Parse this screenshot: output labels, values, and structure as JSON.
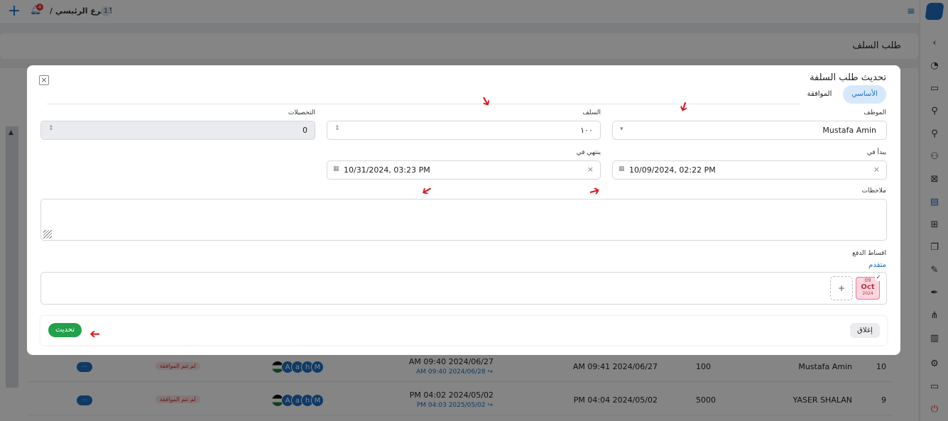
{
  "topbar": {
    "breadcrumb": "الفرع الرئيسي /",
    "branch_number": "1",
    "notifications_count": "4"
  },
  "page": {
    "title": "طلب السلف"
  },
  "table": {
    "rows": [
      {
        "index": "10",
        "employee": "Mustafa Amin",
        "amount": "100",
        "created": "AM 09:41 2024/06/27",
        "period_start": "AM 09:40 2024/06/27",
        "period_end": "AM 09:40 2024/06/28 ↪",
        "avatars": [
          "A",
          "a",
          "h",
          "M"
        ],
        "status": "لم تتم الموافقة",
        "actions": "···"
      },
      {
        "index": "9",
        "employee": "YASER SHALAN",
        "amount": "5000",
        "created": "PM 04:04 2024/05/02",
        "period_start": "PM 04:02 2024/05/02",
        "period_end": "PM 04:03 2025/05/02 ↪",
        "avatars": [
          "A",
          "a",
          "h",
          "M"
        ],
        "status": "لم تتم الموافقة",
        "actions": "···"
      }
    ]
  },
  "modal": {
    "title": "تحديث طلب السلفة",
    "tabs": [
      {
        "label": "الأساسي",
        "active": true
      },
      {
        "label": "الموافقة",
        "active": false
      }
    ],
    "fields": {
      "employee": {
        "label": "الموظف",
        "value": "Mustafa Amin"
      },
      "advance": {
        "label": "السلف",
        "value": "١٠٠"
      },
      "collections": {
        "label": "التحصيلات",
        "value": "0"
      },
      "starts_at": {
        "label": "يبدأ في",
        "value": "10/09/2024, 02:22 PM"
      },
      "ends_at": {
        "label": "ينتهي في",
        "value": "10/31/2024, 03:23 PM"
      },
      "notes": {
        "label": "ملاحظات",
        "value": ""
      }
    },
    "installments": {
      "label": "اقساط الدفع",
      "advanced_link": "متقدم",
      "chip": {
        "day": "09",
        "month": "Oct",
        "year": "2024"
      },
      "add": "+"
    },
    "footer": {
      "close_label": "إغلاق",
      "update_label": "تحديث"
    }
  },
  "colors": {
    "accent": "#1d6fc4",
    "success": "#23a04a",
    "danger": "#e0161b"
  }
}
